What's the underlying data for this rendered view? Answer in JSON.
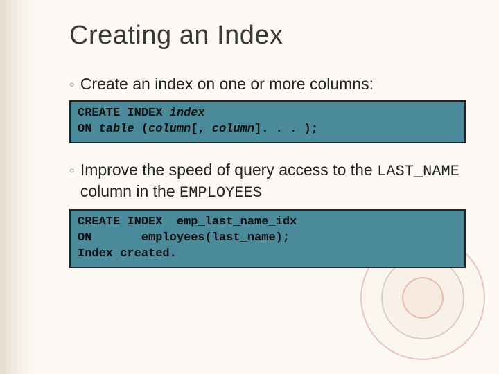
{
  "slide": {
    "title": "Creating an Index",
    "bullets": [
      {
        "marker": "◦",
        "text_before": "Create an index on one or more columns:",
        "mono1": "",
        "text_mid": "",
        "mono2": ""
      },
      {
        "marker": "◦",
        "text_before": "Improve the speed of query access to the ",
        "mono1": "LAST_NAME",
        "text_mid": " column in the ",
        "mono2": "EMPLOYEES"
      }
    ],
    "code1": {
      "line1_a": "CREATE INDEX ",
      "line1_b": "index",
      "line2_a": "ON ",
      "line2_b": "table",
      "line2_c": " (",
      "line2_d": "column",
      "line2_e": "[, ",
      "line2_f": "column",
      "line2_g": "]. . . );"
    },
    "code2": {
      "line1": "CREATE INDEX  emp_last_name_idx",
      "line2": "ON       employees(last_name);",
      "line3": "Index created."
    }
  }
}
